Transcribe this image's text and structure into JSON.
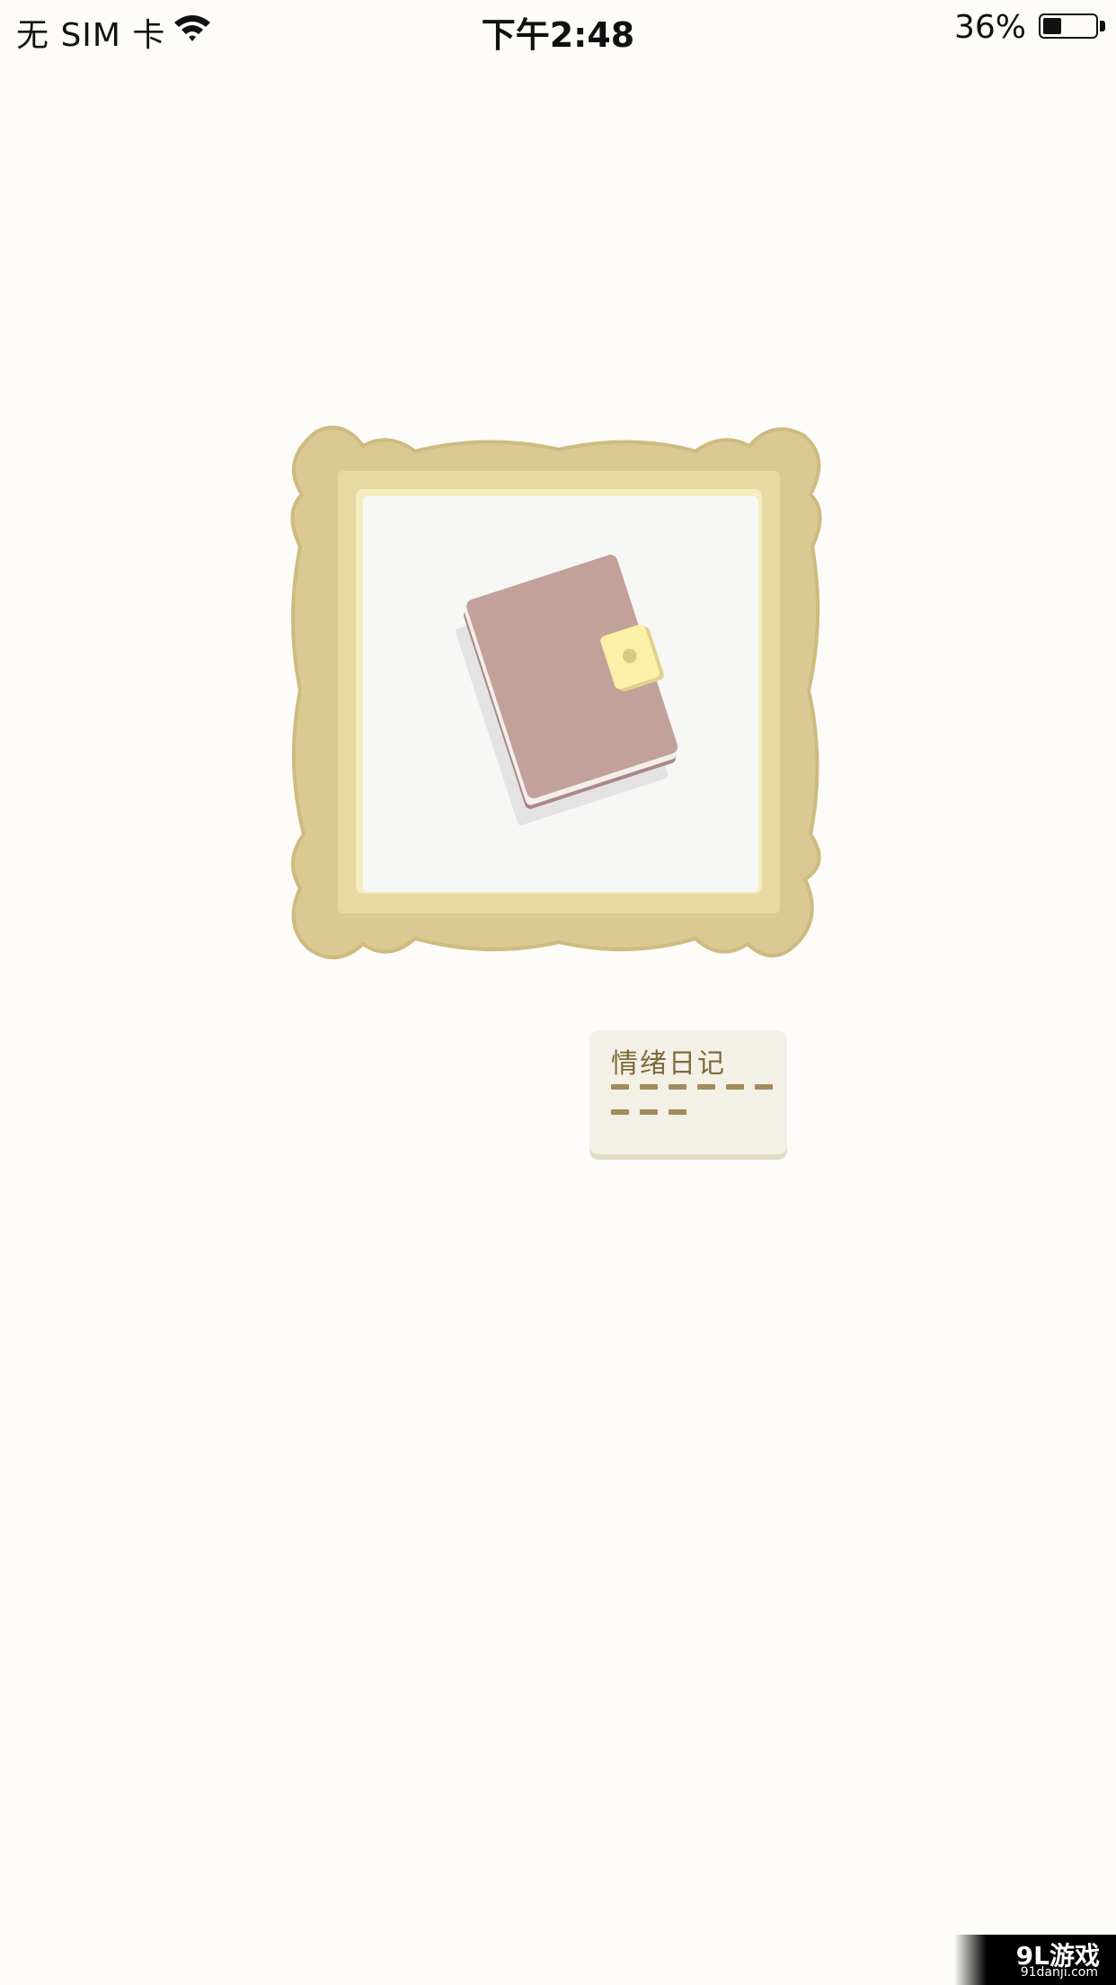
{
  "status_bar": {
    "carrier": "无 SIM 卡",
    "time": "下午2:48",
    "battery_percent": "36%",
    "battery_level": 0.36
  },
  "frame": {
    "content_icon": "diary-notebook-icon",
    "colors": {
      "frame_outer": "#d9c890",
      "frame_inner": "#e6d9a3",
      "notebook_cover": "#c2a19a",
      "clasp": "#fbf0a8"
    }
  },
  "entry_card": {
    "title": "情绪日记"
  },
  "watermark": {
    "logo": "9L游戏",
    "url": "91danji.com"
  }
}
